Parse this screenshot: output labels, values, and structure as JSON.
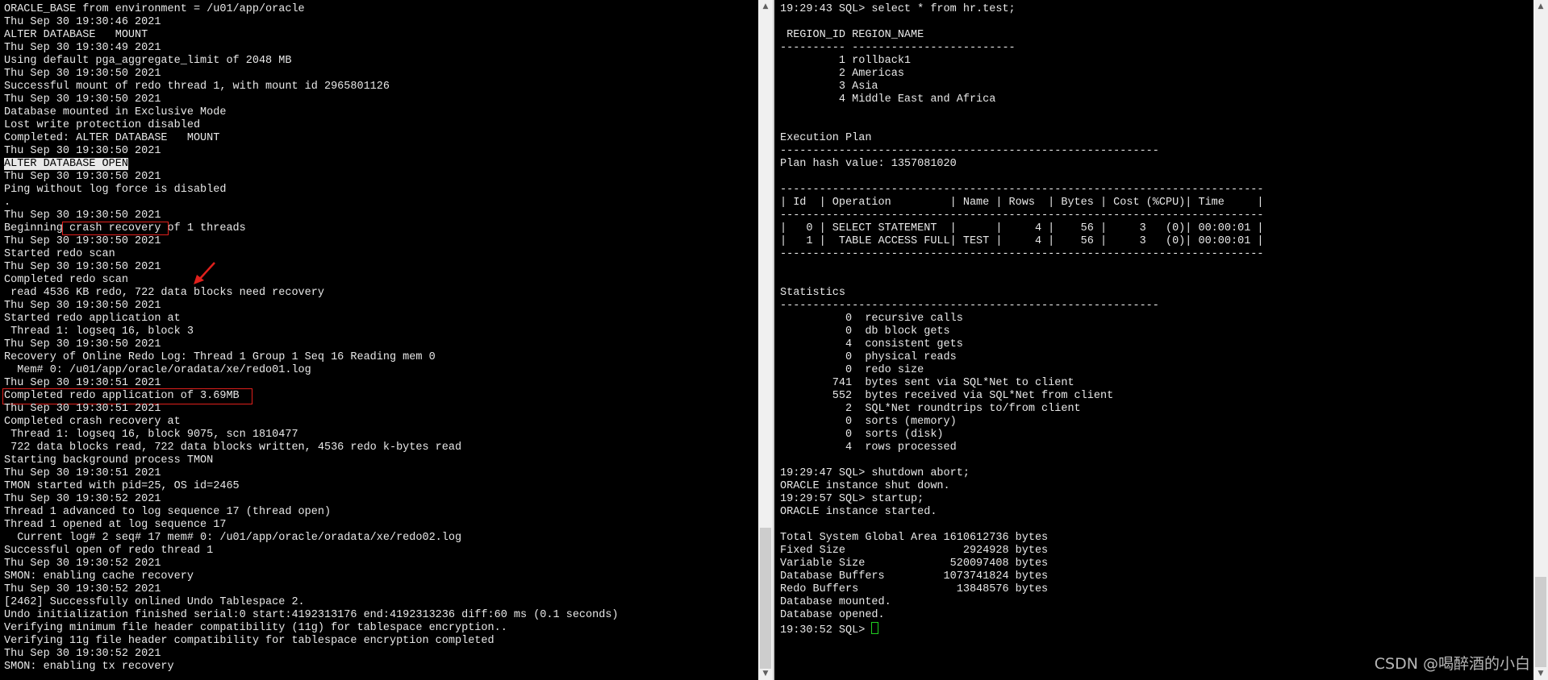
{
  "left_terminal": {
    "lines": [
      "ORACLE_BASE from environment = /u01/app/oracle",
      "Thu Sep 30 19:30:46 2021",
      "ALTER DATABASE   MOUNT",
      "Thu Sep 30 19:30:49 2021",
      "Using default pga_aggregate_limit of 2048 MB",
      "Thu Sep 30 19:30:50 2021",
      "Successful mount of redo thread 1, with mount id 2965801126",
      "Thu Sep 30 19:30:50 2021",
      "Database mounted in Exclusive Mode",
      "Lost write protection disabled",
      "Completed: ALTER DATABASE   MOUNT",
      "Thu Sep 30 19:30:50 2021",
      {
        "type": "highlight",
        "text": "ALTER DATABASE OPEN"
      },
      "Thu Sep 30 19:30:50 2021",
      "Ping without log force is disabled",
      ".",
      "Thu Sep 30 19:30:50 2021",
      {
        "type": "boxed",
        "pre": "Beginning",
        "boxed": " crash recovery ",
        "post": "of 1 threads"
      },
      "Thu Sep 30 19:30:50 2021",
      "Started redo scan",
      "Thu Sep 30 19:30:50 2021",
      "Completed redo scan",
      " read 4536 KB redo, 722 data blocks need recovery",
      "Thu Sep 30 19:30:50 2021",
      "Started redo application at",
      " Thread 1: logseq 16, block 3",
      "Thu Sep 30 19:30:50 2021",
      "Recovery of Online Redo Log: Thread 1 Group 1 Seq 16 Reading mem 0",
      "  Mem# 0: /u01/app/oracle/oradata/xe/redo01.log",
      "Thu Sep 30 19:30:51 2021",
      {
        "type": "boxline",
        "text": "Completed redo application of 3.69MB"
      },
      "Thu Sep 30 19:30:51 2021",
      "Completed crash recovery at",
      " Thread 1: logseq 16, block 9075, scn 1810477",
      " 722 data blocks read, 722 data blocks written, 4536 redo k-bytes read",
      "Starting background process TMON",
      "Thu Sep 30 19:30:51 2021",
      "TMON started with pid=25, OS id=2465",
      "Thu Sep 30 19:30:52 2021",
      "Thread 1 advanced to log sequence 17 (thread open)",
      "Thread 1 opened at log sequence 17",
      "  Current log# 2 seq# 17 mem# 0: /u01/app/oracle/oradata/xe/redo02.log",
      "Successful open of redo thread 1",
      "Thu Sep 30 19:30:52 2021",
      "SMON: enabling cache recovery",
      "Thu Sep 30 19:30:52 2021",
      "[2462] Successfully onlined Undo Tablespace 2.",
      "Undo initialization finished serial:0 start:4192313176 end:4192313236 diff:60 ms (0.1 seconds)",
      "Verifying minimum file header compatibility (11g) for tablespace encryption..",
      "Verifying 11g file header compatibility for tablespace encryption completed",
      "Thu Sep 30 19:30:52 2021",
      "SMON: enabling tx recovery"
    ]
  },
  "right_terminal": {
    "lines": [
      "19:29:43 SQL> select * from hr.test;",
      "",
      " REGION_ID REGION_NAME",
      "---------- -------------------------",
      "         1 rollback1",
      "         2 Americas",
      "         3 Asia",
      "         4 Middle East and Africa",
      "",
      "",
      "Execution Plan",
      "----------------------------------------------------------",
      "Plan hash value: 1357081020",
      "",
      "--------------------------------------------------------------------------",
      "| Id  | Operation         | Name | Rows  | Bytes | Cost (%CPU)| Time     |",
      "--------------------------------------------------------------------------",
      "|   0 | SELECT STATEMENT  |      |     4 |    56 |     3   (0)| 00:00:01 |",
      "|   1 |  TABLE ACCESS FULL| TEST |     4 |    56 |     3   (0)| 00:00:01 |",
      "--------------------------------------------------------------------------",
      "",
      "",
      "Statistics",
      "----------------------------------------------------------",
      "          0  recursive calls",
      "          0  db block gets",
      "          4  consistent gets",
      "          0  physical reads",
      "          0  redo size",
      "        741  bytes sent via SQL*Net to client",
      "        552  bytes received via SQL*Net from client",
      "          2  SQL*Net roundtrips to/from client",
      "          0  sorts (memory)",
      "          0  sorts (disk)",
      "          4  rows processed",
      "",
      "19:29:47 SQL> shutdown abort;",
      "ORACLE instance shut down.",
      "19:29:57 SQL> startup;",
      "ORACLE instance started.",
      "",
      "Total System Global Area 1610612736 bytes",
      "Fixed Size                  2924928 bytes",
      "Variable Size             520097408 bytes",
      "Database Buffers         1073741824 bytes",
      "Redo Buffers               13848576 bytes",
      "Database mounted.",
      "Database opened.",
      {
        "type": "prompt",
        "text": "19:30:52 SQL> "
      }
    ]
  },
  "scrollbars": {
    "left": {
      "up_icon": "▲",
      "down_icon": "▼",
      "position_fraction": 0.78
    },
    "right": {
      "up_icon": "▲",
      "down_icon": "▼",
      "position_fraction": 0.85
    }
  },
  "watermark": "CSDN @喝醉酒的小白",
  "colors": {
    "annotation_red": "#e0201c",
    "cursor_green": "#20d020",
    "text": "#e8e8e8",
    "background": "#000000"
  }
}
